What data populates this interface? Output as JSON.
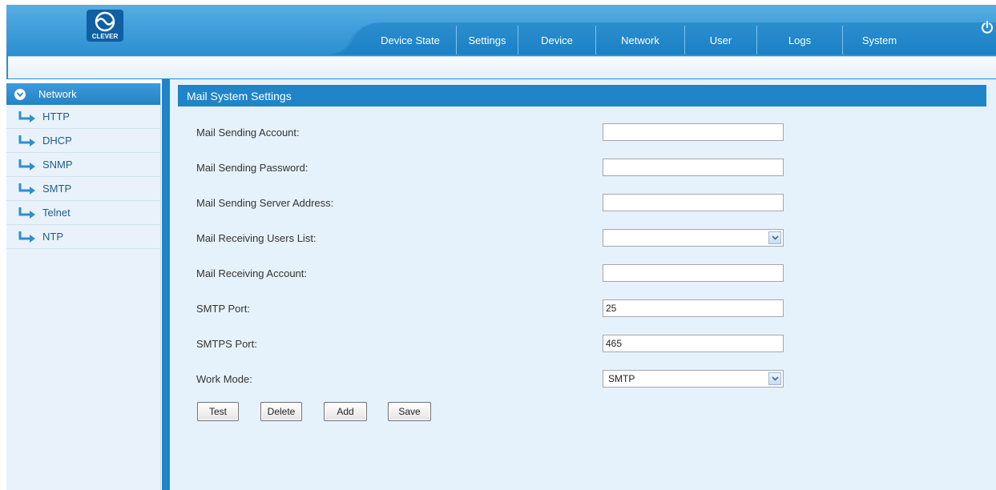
{
  "brand": {
    "logo_text": "CLEVER"
  },
  "nav": {
    "tabs": [
      {
        "label": "Device State"
      },
      {
        "label": "Settings"
      },
      {
        "label": "Device"
      },
      {
        "label": "Network"
      },
      {
        "label": "User"
      },
      {
        "label": "Logs"
      },
      {
        "label": "System"
      }
    ]
  },
  "sidebar": {
    "header": "Network",
    "items": [
      {
        "label": "HTTP"
      },
      {
        "label": "DHCP"
      },
      {
        "label": "SNMP"
      },
      {
        "label": "SMTP"
      },
      {
        "label": "Telnet"
      },
      {
        "label": "NTP"
      }
    ]
  },
  "main": {
    "section_title": "Mail System Settings",
    "fields": {
      "sending_account": {
        "label": "Mail Sending Account:",
        "value": ""
      },
      "sending_password": {
        "label": "Mail Sending Password:",
        "value": ""
      },
      "server_address": {
        "label": "Mail Sending Server Address:",
        "value": ""
      },
      "receiving_users": {
        "label": "Mail Receiving Users List:",
        "value": ""
      },
      "receiving_account": {
        "label": "Mail Receiving Account:",
        "value": ""
      },
      "smtp_port": {
        "label": "SMTP Port:",
        "value": "25"
      },
      "smtps_port": {
        "label": "SMTPS Port:",
        "value": "465"
      },
      "work_mode": {
        "label": "Work Mode:",
        "value": "SMTP"
      }
    },
    "buttons": {
      "test": "Test",
      "delete": "Delete",
      "add": "Add",
      "save": "Save"
    }
  },
  "colors": {
    "primary_blue": "#1f84c8",
    "header_light": "#5fb2e4",
    "content_bg": "#e6f2fb",
    "sidebar_bg": "#e9f2fa"
  },
  "icons": {
    "logo": "clever-logo-icon",
    "power": "power-icon",
    "sidebar_header": "chevron-down-circle-icon",
    "sidebar_item": "arrow-right-bent-icon",
    "select": "chevron-down-icon"
  }
}
